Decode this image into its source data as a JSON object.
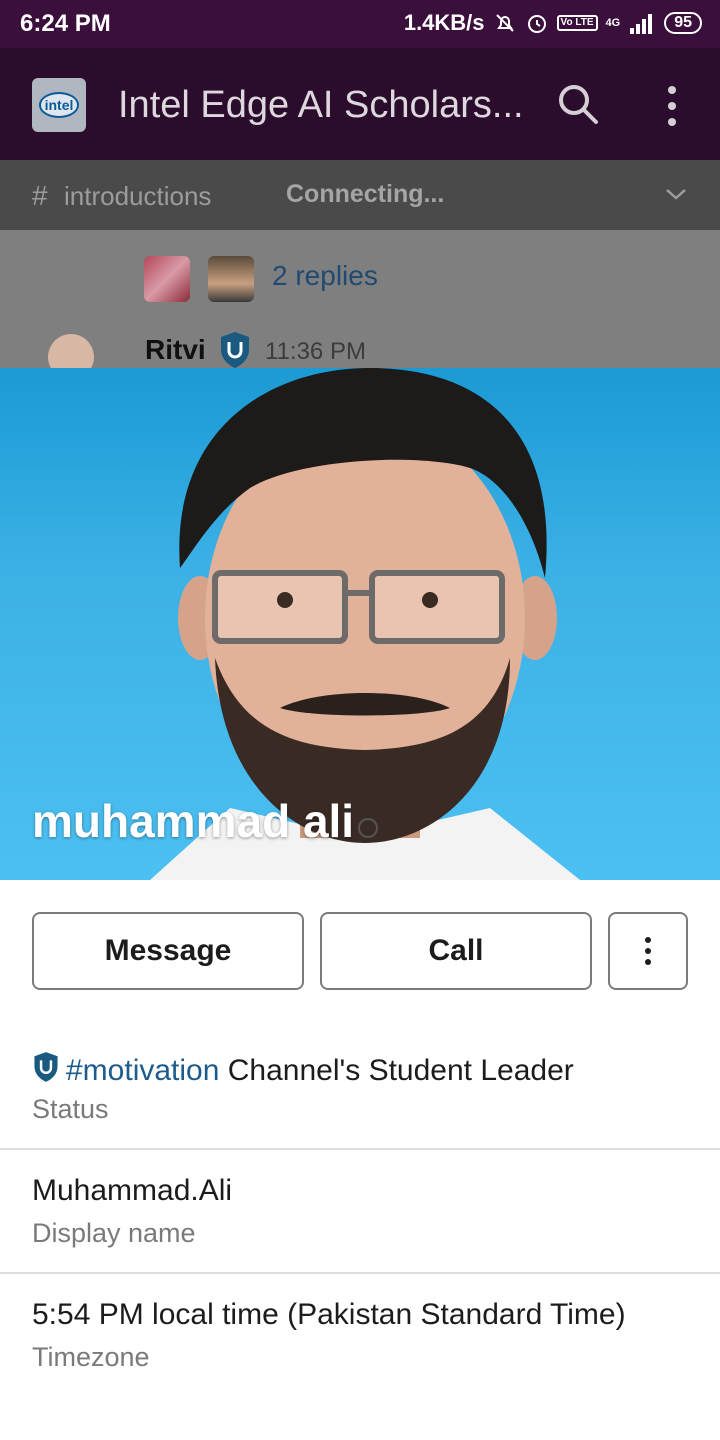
{
  "status_bar": {
    "time": "6:24 PM",
    "network_speed": "1.4KB/s",
    "network_type": "4G",
    "volte": "Vo LTE",
    "battery": "95",
    "icons": [
      "mute-bell-icon",
      "alarm-icon",
      "volte-icon",
      "signal-icon",
      "signal-icon",
      "battery-icon"
    ]
  },
  "app_bar": {
    "workspace_logo_text": "intel",
    "title": "Intel Edge AI Scholars...",
    "search_icon": "search-icon",
    "menu_icon": "more-vertical-icon"
  },
  "channel_bar": {
    "hash": "#",
    "channel": "introductions",
    "connection_status": "Connecting...",
    "chevron_icon": "chevron-down-icon"
  },
  "background_thread": {
    "replies": "2 replies",
    "sender": "Ritvi",
    "timestamp": "11:36 PM"
  },
  "profile": {
    "name": "muhammad ali",
    "actions": {
      "message": "Message",
      "call": "Call",
      "more_icon": "more-vertical-icon"
    },
    "fields": [
      {
        "value_link": "#motivation",
        "value_text": " Channel's Student Leader",
        "label": "Status"
      },
      {
        "value": "Muhammad.Ali",
        "label": "Display name"
      },
      {
        "value": "5:54 PM local time (Pakistan Standard Time)",
        "label": "Timezone"
      }
    ]
  },
  "colors": {
    "status_bar_bg": "#3b0f3b",
    "app_bar_bg": "#2b0c2d",
    "link": "#1d5b8c",
    "badge": "#1a5a80"
  }
}
